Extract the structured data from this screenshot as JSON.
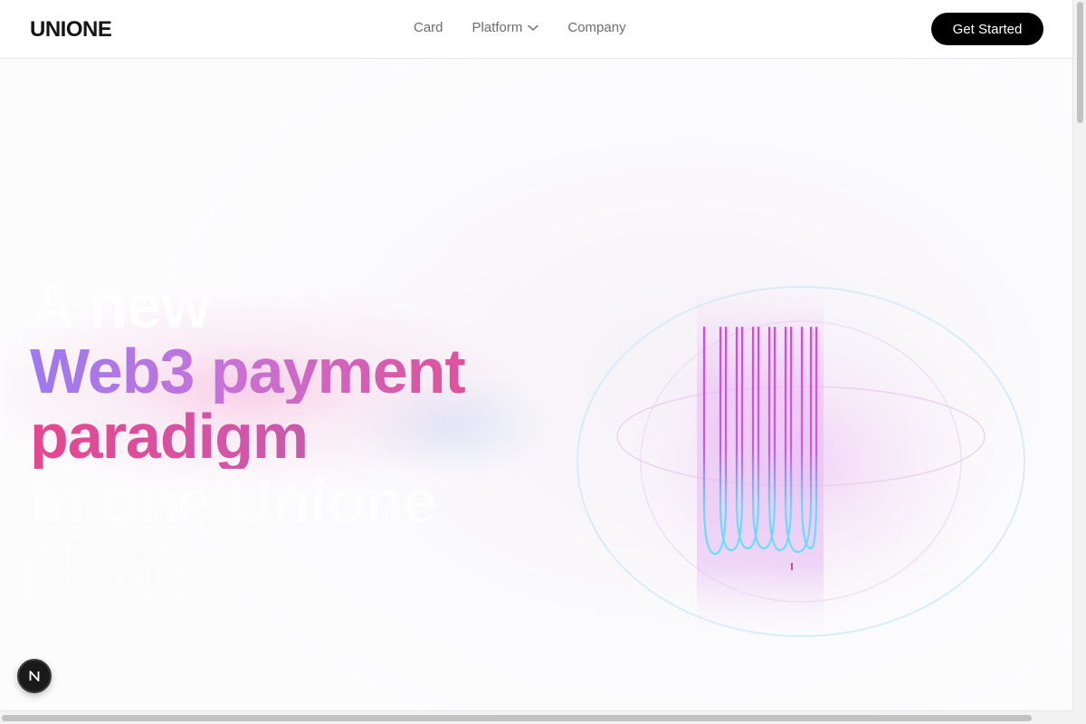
{
  "header": {
    "logo": "UNIONE",
    "nav": [
      {
        "label": "Card"
      },
      {
        "label": "Platform"
      },
      {
        "label": "Company"
      }
    ],
    "cta_label": "Get Started"
  },
  "hero": {
    "line1": "A new",
    "line2": "Web3 payment",
    "line3": "paradigm",
    "line4": "in one Unione",
    "line5": "platform."
  },
  "badge": {
    "letter": "N"
  },
  "icons": {
    "platform_chevron": "chevron-down-icon"
  },
  "colors": {
    "cta_bg": "#000000",
    "gradient_start": "#9d79f2",
    "gradient_mid": "#c673d6",
    "gradient_end": "#e0509a",
    "orb_magenta": "#e040f0",
    "orb_cyan": "#5fe0ff"
  }
}
